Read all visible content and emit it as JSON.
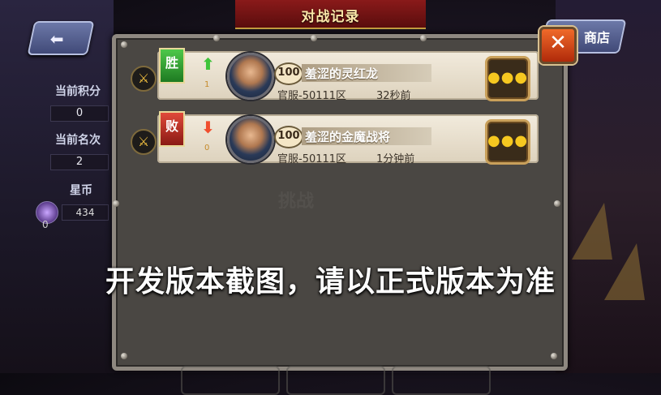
{
  "header": {
    "title": "对战记录"
  },
  "nav": {
    "back_icon": "arrow-left-icon",
    "shop_label": "商店"
  },
  "sidebar": {
    "score_label": "当前积分",
    "score_value": "0",
    "rank_label": "当前名次",
    "rank_value": "2",
    "coin_label": "星币",
    "coin_value": "434",
    "coin_extra": "0"
  },
  "records": [
    {
      "result": "胜",
      "result_type": "win",
      "change_icon": "arrow-up-icon",
      "change": "1",
      "level": "100",
      "name": "羞涩的灵红龙",
      "server": "官服-50111区",
      "time": "32秒前",
      "more_label": "●●●"
    },
    {
      "result": "败",
      "result_type": "lose",
      "change_icon": "arrow-down-icon",
      "change": "0",
      "level": "100",
      "name": "羞涩的金魔战将",
      "server": "官服-50111区",
      "time": "1分钟前",
      "more_label": "●●●"
    }
  ],
  "background_text": {
    "challenge": "挑战"
  },
  "close": {
    "label": "✕"
  },
  "watermark": "开发版本截图，请以正式版本为准",
  "colors": {
    "win": "#2e9a2c",
    "lose": "#b8241a",
    "accent": "#f6c820",
    "panel": "#4a4743"
  }
}
